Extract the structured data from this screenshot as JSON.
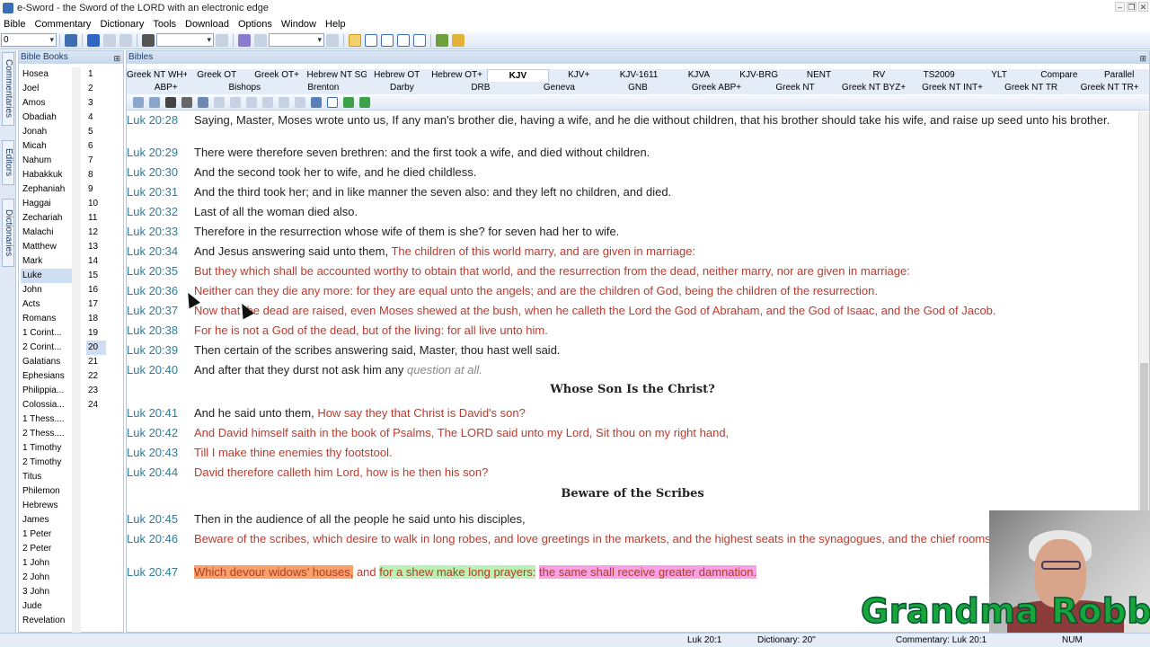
{
  "window": {
    "title": "e-Sword - the Sword of the LORD with an electronic edge"
  },
  "menu": [
    "Bible",
    "Commentary",
    "Dictionary",
    "Tools",
    "Download",
    "Options",
    "Window",
    "Help"
  ],
  "toolbar": {
    "chapter_combo_value": "0"
  },
  "side_tabs": [
    "Commentaries",
    "Editors",
    "Dictionaries"
  ],
  "books_panel": {
    "title": "Bible Books",
    "books": [
      "Hosea",
      "Joel",
      "Amos",
      "Obadiah",
      "Jonah",
      "Micah",
      "Nahum",
      "Habakkuk",
      "Zephaniah",
      "Haggai",
      "Zechariah",
      "Malachi",
      "Matthew",
      "Mark",
      "Luke",
      "John",
      "Acts",
      "Romans",
      "1 Corint...",
      "2 Corint...",
      "Galatians",
      "Ephesians",
      "Philippia...",
      "Colossia...",
      "1 Thess....",
      "2 Thess....",
      "1 Timothy",
      "2 Timothy",
      "Titus",
      "Philemon",
      "Hebrews",
      "James",
      "1 Peter",
      "2 Peter",
      "1 John",
      "2 John",
      "3 John",
      "Jude",
      "Revelation"
    ],
    "selected_book": "Luke",
    "chapters": [
      "1",
      "2",
      "3",
      "4",
      "5",
      "6",
      "7",
      "8",
      "9",
      "10",
      "11",
      "12",
      "13",
      "14",
      "15",
      "16",
      "17",
      "18",
      "19",
      "20",
      "21",
      "22",
      "23",
      "24"
    ],
    "selected_chapter": "20"
  },
  "bibles_panel": {
    "title": "Bibles",
    "tabs_row1": [
      "Greek NT WH+",
      "Greek OT",
      "Greek OT+",
      "Hebrew NT SG",
      "Hebrew OT",
      "Hebrew OT+",
      "KJV",
      "KJV+",
      "KJV-1611",
      "KJVA",
      "KJV-BRG",
      "NENT",
      "RV",
      "TS2009",
      "YLT",
      "Compare",
      "Parallel"
    ],
    "tabs_row2": [
      "ABP+",
      "Bishops",
      "Brenton",
      "Darby",
      "DRB",
      "Geneva",
      "GNB",
      "Greek ABP+",
      "Greek NT",
      "Greek NT BYZ+",
      "Greek NT INT+",
      "Greek NT TR",
      "Greek NT TR+"
    ],
    "active_tab": "KJV",
    "verses": [
      {
        "ref": "Luk 20:28",
        "parts": [
          {
            "t": "Saying, Master, Moses wrote unto us, If any man's brother die, having a wife, and he die without children, that his brother should take his wife, and raise up seed unto his brother.",
            "s": "plain"
          }
        ]
      },
      {
        "ref": "Luk 20:29",
        "parts": [
          {
            "t": "There were therefore seven brethren: and the first took a wife, and died without children.",
            "s": "plain"
          }
        ]
      },
      {
        "ref": "Luk 20:30",
        "parts": [
          {
            "t": "And the second took her to wife, and he died childless.",
            "s": "plain"
          }
        ]
      },
      {
        "ref": "Luk 20:31",
        "parts": [
          {
            "t": "And the third took her; and in like manner the seven also: and they left no children, and died.",
            "s": "plain"
          }
        ]
      },
      {
        "ref": "Luk 20:32",
        "parts": [
          {
            "t": "Last of all the woman died also.",
            "s": "plain"
          }
        ]
      },
      {
        "ref": "Luk 20:33",
        "parts": [
          {
            "t": "Therefore in the resurrection whose wife of them is she? for seven had her to wife.",
            "s": "plain"
          }
        ]
      },
      {
        "ref": "Luk 20:34",
        "parts": [
          {
            "t": "And Jesus answering said unto them, ",
            "s": "plain"
          },
          {
            "t": "The children of this world marry, and are given in marriage:",
            "s": "red"
          }
        ]
      },
      {
        "ref": "Luk 20:35",
        "parts": [
          {
            "t": "But they which shall be accounted worthy to obtain that world, and the resurrection from the dead, neither marry, nor are given in marriage:",
            "s": "red"
          }
        ]
      },
      {
        "ref": "Luk 20:36",
        "parts": [
          {
            "t": "Neither can they die any more: for they are equal unto the angels; and are the children of God, being the children of the resurrection.",
            "s": "red"
          }
        ]
      },
      {
        "ref": "Luk 20:37",
        "parts": [
          {
            "t": "Now that the dead are raised, even Moses shewed at the bush, when he calleth the Lord the God of Abraham, and the God of Isaac, and the God of Jacob.",
            "s": "red"
          }
        ]
      },
      {
        "ref": "Luk 20:38",
        "parts": [
          {
            "t": "For he is not a God of the dead, but of the living: for all live unto him.",
            "s": "red"
          }
        ]
      },
      {
        "ref": "Luk 20:39",
        "parts": [
          {
            "t": "Then certain of the scribes answering said, Master, thou hast well said.",
            "s": "plain"
          }
        ]
      },
      {
        "ref": "Luk 20:40",
        "parts": [
          {
            "t": "And after that they durst not ask him any ",
            "s": "plain"
          },
          {
            "t": "question at all.",
            "s": "ital"
          }
        ]
      },
      {
        "ref": "Luk 20:41",
        "parts": [
          {
            "t": "And he said unto them, ",
            "s": "plain"
          },
          {
            "t": "How say they that Christ is David's son?",
            "s": "red"
          }
        ]
      },
      {
        "ref": "Luk 20:42",
        "parts": [
          {
            "t": "And David himself saith in the book of Psalms, The LORD said unto my Lord, Sit thou on my right hand,",
            "s": "red"
          }
        ]
      },
      {
        "ref": "Luk 20:43",
        "parts": [
          {
            "t": "Till I make thine enemies thy footstool.",
            "s": "red"
          }
        ]
      },
      {
        "ref": "Luk 20:44",
        "parts": [
          {
            "t": "David therefore calleth him Lord, how is he then his son?",
            "s": "red"
          }
        ]
      },
      {
        "ref": "Luk 20:45",
        "parts": [
          {
            "t": "Then in the audience of all the people he said unto his disciples,",
            "s": "plain"
          }
        ]
      },
      {
        "ref": "Luk 20:46",
        "parts": [
          {
            "t": "Beware of the scribes, which desire to walk in long robes, and love greetings in the markets, and the highest seats in the synagogues, and the chief rooms at feasts;",
            "s": "red"
          }
        ]
      },
      {
        "ref": "Luk 20:47",
        "parts": [
          {
            "t": "Which devour widows' houses,",
            "s": "hl-orange"
          },
          {
            "t": " and ",
            "s": "red"
          },
          {
            "t": "for a shew make long prayers:",
            "s": "hl-green"
          },
          {
            "t": " ",
            "s": "red"
          },
          {
            "t": "the same shall receive greater damnation.",
            "s": "hl-pink"
          }
        ]
      }
    ],
    "headings": [
      "Whose Son Is the Christ?",
      "Beware of the Scribes"
    ]
  },
  "statusbar": {
    "location": "Luk 20:1",
    "dictionary": "Dictionary: 20\"",
    "commentary": "Commentary: Luk 20:1",
    "num": "NUM"
  },
  "overlay": {
    "watermark": "Grandma Robbin"
  }
}
